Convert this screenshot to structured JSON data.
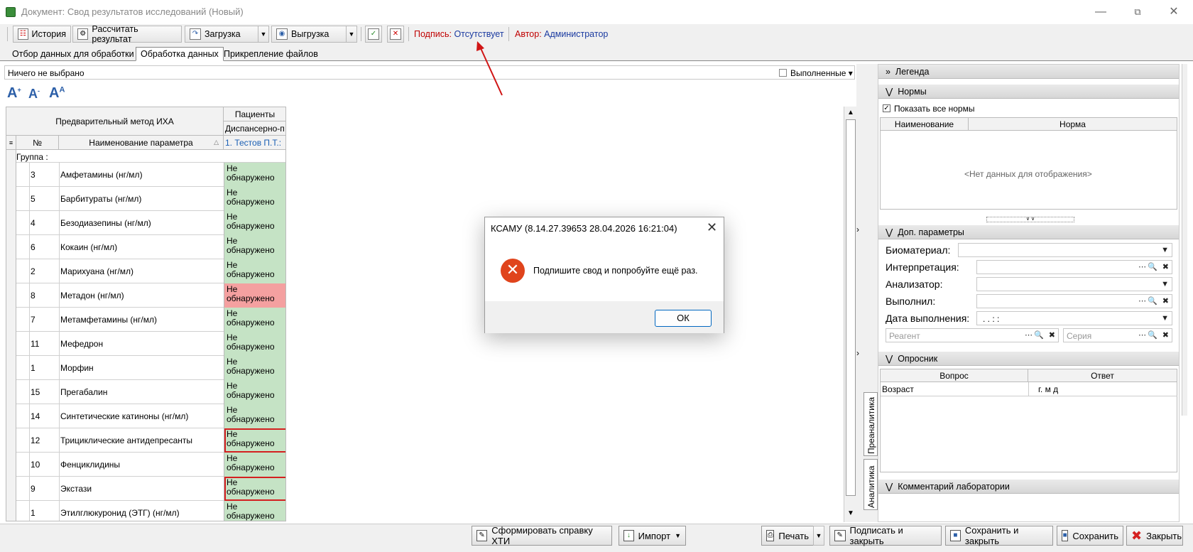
{
  "window": {
    "title": "Документ: Свод результатов исследований (Новый)"
  },
  "toolbar": {
    "history": "История",
    "calculate": "Рассчитать результат",
    "load": "Загрузка",
    "export": "Выгрузка",
    "signature_label": "Подпись:",
    "signature_value": "Отсутствует",
    "author_label": "Автор:",
    "author_value": "Администратор"
  },
  "tabs": [
    "Отбор данных для обработки",
    "Обработка данных",
    "Прикрепление файлов"
  ],
  "filter": {
    "text": "Ничего не выбрано",
    "completed": "Выполненные"
  },
  "grid": {
    "header_method": "Предварительный метод ИХА",
    "header_patients": "Пациенты",
    "header_dispensary": "Диспансерно-п",
    "col_num": "№",
    "col_name": "Наименование параметра",
    "patient": "1. Тестов П.Т.:",
    "group_label": "Группа :",
    "rows": [
      {
        "num": "3",
        "name": "Амфетамины (нг/мл)",
        "result": "Не обнаружено",
        "status": "green"
      },
      {
        "num": "5",
        "name": "Барбитураты (нг/мл)",
        "result": "Не обнаружено",
        "status": "green"
      },
      {
        "num": "4",
        "name": "Безодиазепины (нг/мл)",
        "result": "Не обнаружено",
        "status": "green"
      },
      {
        "num": "6",
        "name": "Кокаин (нг/мл)",
        "result": "Не обнаружено",
        "status": "green"
      },
      {
        "num": "2",
        "name": "Марихуана (нг/мл)",
        "result": "Не обнаружено",
        "status": "green"
      },
      {
        "num": "8",
        "name": "Метадон (нг/мл)",
        "result": "Не обнаружено",
        "status": "red"
      },
      {
        "num": "7",
        "name": "Метамфетамины (нг/мл)",
        "result": "Не обнаружено",
        "status": "green"
      },
      {
        "num": "11",
        "name": "Мефедрон",
        "result": "Не обнаружено",
        "status": "green"
      },
      {
        "num": "1",
        "name": "Морфин",
        "result": "Не обнаружено",
        "status": "green"
      },
      {
        "num": "15",
        "name": "Прегабалин",
        "result": "Не обнаружено",
        "status": "green"
      },
      {
        "num": "14",
        "name": "Синтетические катиноны (нг/мл)",
        "result": "Не обнаружено",
        "status": "green"
      },
      {
        "num": "12",
        "name": "Трициклические антидепресанты",
        "result": "Не обнаружено",
        "status": "outlined"
      },
      {
        "num": "10",
        "name": "Фенциклидины",
        "result": "Не обнаружено",
        "status": "green"
      },
      {
        "num": "9",
        "name": "Экстази",
        "result": "Не обнаружено",
        "status": "outlined"
      },
      {
        "num": "1",
        "name": "Этилглюкуронид (ЭТГ) (нг/мл)",
        "result": "Не обнаружено",
        "status": "green"
      }
    ]
  },
  "right": {
    "legend": "Легенда",
    "norms": "Нормы",
    "show_all_norms": "Показать все нормы",
    "norms_col_name": "Наименование",
    "norms_col_norm": "Норма",
    "no_data": "<Нет данных для отображения>",
    "extra_params": "Доп. параметры",
    "biomaterial": "Биоматериал:",
    "interpretation": "Интерпретация:",
    "analyzer": "Анализатор:",
    "performed_by": "Выполнил:",
    "date_done": "Дата выполнения:",
    "date_mask": ". .     : :",
    "reagent_placeholder": "Реагент",
    "series_placeholder": "Серия",
    "questionnaire": "Опросник",
    "q_col_question": "Вопрос",
    "q_col_answer": "Ответ",
    "q_row_question": "Возраст",
    "q_row_answer": "г.   м   д",
    "lab_comment": "Комментарий лаборатории"
  },
  "side_tabs": {
    "preanalytics": "Преаналитика",
    "analytics": "Аналитика"
  },
  "bottom": {
    "make_report": "Сформировать справку ХТИ",
    "import": "Импорт",
    "print": "Печать",
    "sign_close": "Подписать и закрыть",
    "save_close": "Сохранить и закрыть",
    "save": "Сохранить",
    "close": "Закрыть"
  },
  "dialog": {
    "title": "КСАМУ (8.14.27.39653 28.04.2026 16:21:04)",
    "message": "Подпишите свод и попробуйте ещё раз.",
    "ok": "ОК"
  },
  "colors": {
    "green": "#c5e3c5",
    "red": "#f4a0a0",
    "outline": "#d42020",
    "error": "#e0441c"
  }
}
